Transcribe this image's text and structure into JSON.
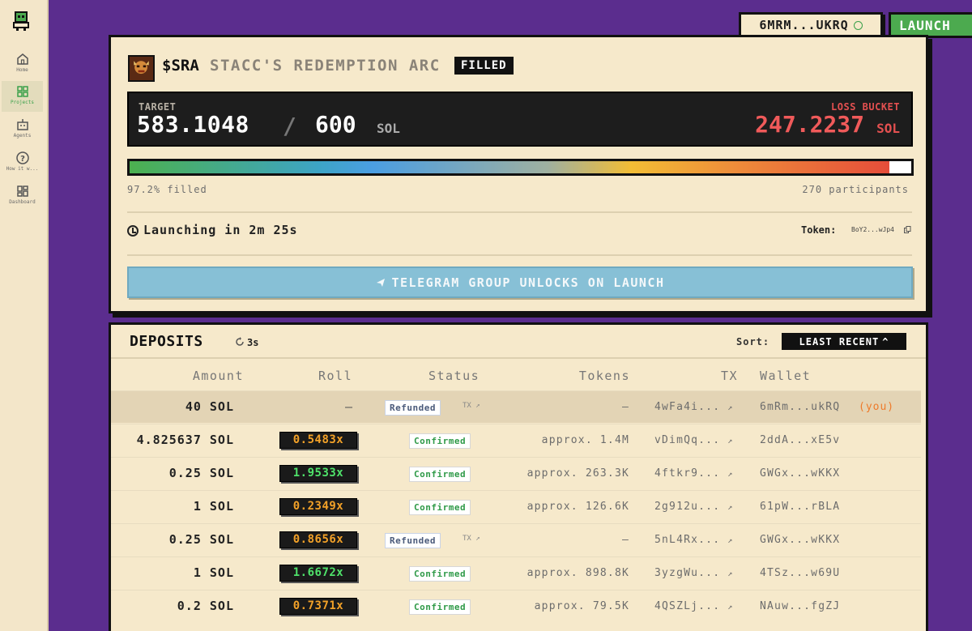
{
  "sidebar": {
    "items": [
      {
        "label": "Home",
        "icon": "home-icon"
      },
      {
        "label": "Projects",
        "icon": "grid-icon"
      },
      {
        "label": "Agents",
        "icon": "robot-icon"
      },
      {
        "label": "How it w...",
        "icon": "question-icon"
      },
      {
        "label": "Dashboard",
        "icon": "dashboard-icon"
      }
    ]
  },
  "header": {
    "wallet": "6MRM...UKRQ",
    "launch_label": "LAUNCH"
  },
  "project": {
    "ticker": "$SRA",
    "name": "STACC'S REDEMPTION ARC",
    "badge": "FILLED",
    "target_label": "TARGET",
    "target_value": "583.1048",
    "target_sep": "/",
    "target_max": "600",
    "target_unit": "SOL",
    "loss_label": "LOSS BUCKET",
    "loss_value": "247.2237",
    "loss_unit": "SOL",
    "progress": 0.972,
    "filled_text": "97.2% filled",
    "participants_text": "270 participants",
    "launching_text": "Launching in 2m 25s",
    "token_label": "Token:",
    "token_value": "BoY2...wJp4",
    "telegram_text": "TELEGRAM GROUP UNLOCKS ON LAUNCH"
  },
  "deposits": {
    "title": "DEPOSITS",
    "refresh": "3s",
    "sort_label": "Sort:",
    "sort_value": "LEAST RECENT",
    "columns": [
      "Amount",
      "Roll",
      "Status",
      "Tokens",
      "TX",
      "Wallet"
    ],
    "rows": [
      {
        "amount": "40 SOL",
        "roll": "—",
        "status": "Refunded",
        "tx_link": "TX",
        "tokens": "—",
        "tx": "4wFa4i...",
        "wallet": "6mRm...ukRQ",
        "you": "(you)"
      },
      {
        "amount": "4.825637 SOL",
        "roll": "0.5483x",
        "status": "Confirmed",
        "tokens": "approx. 1.4M",
        "tx": "vDimQq...",
        "wallet": "2ddA...xE5v"
      },
      {
        "amount": "0.25 SOL",
        "roll": "1.9533x",
        "status": "Confirmed",
        "tokens": "approx. 263.3K",
        "tx": "4ftkr9...",
        "wallet": "GWGx...wKKX"
      },
      {
        "amount": "1 SOL",
        "roll": "0.2349x",
        "status": "Confirmed",
        "tokens": "approx. 126.6K",
        "tx": "2g912u...",
        "wallet": "61pW...rBLA"
      },
      {
        "amount": "0.25 SOL",
        "roll": "0.8656x",
        "status": "Refunded",
        "tx_link": "TX",
        "tokens": "—",
        "tx": "5nL4Rx...",
        "wallet": "GWGx...wKKX"
      },
      {
        "amount": "1 SOL",
        "roll": "1.6672x",
        "status": "Confirmed",
        "tokens": "approx. 898.8K",
        "tx": "3yzgWu...",
        "wallet": "4TSz...w69U"
      },
      {
        "amount": "0.2 SOL",
        "roll": "0.7371x",
        "status": "Confirmed",
        "tokens": "approx. 79.5K",
        "tx": "4QSZLj...",
        "wallet": "NAuw...fgZJ"
      }
    ]
  },
  "colors": {
    "background": "#5b2d8e",
    "card": "#f6e9cb",
    "accent_green": "#4caa4f",
    "loss_red": "#f05a5a",
    "roll_gold": "#f2a128",
    "roll_green": "#4fe26a"
  }
}
